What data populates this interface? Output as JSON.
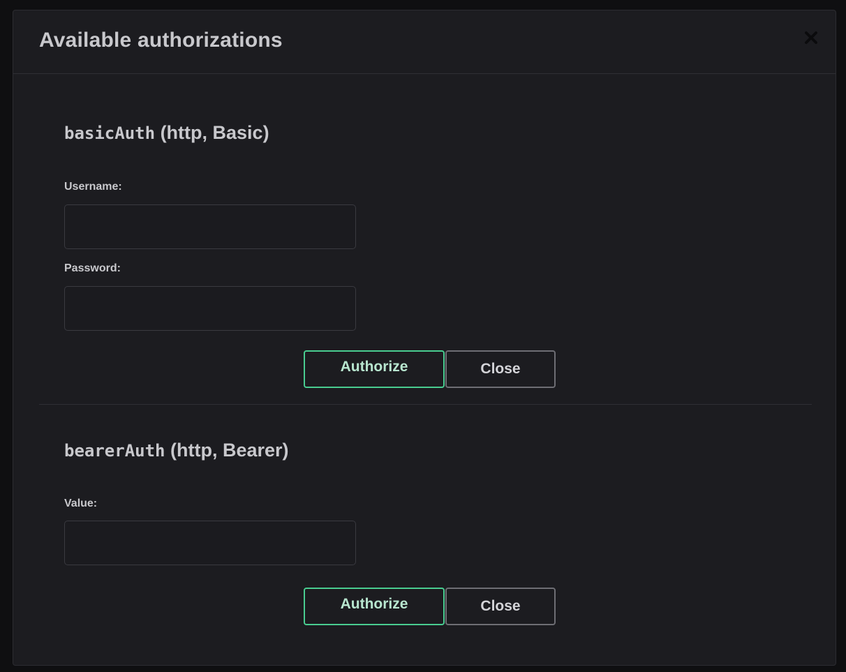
{
  "modal": {
    "title": "Available authorizations",
    "close_icon": "close-icon"
  },
  "sections": [
    {
      "scheme_name": "basicAuth",
      "scheme_type": "(http, Basic)",
      "fields": [
        {
          "label": "Username:",
          "value": "",
          "placeholder": ""
        },
        {
          "label": "Password:",
          "value": "",
          "placeholder": ""
        }
      ],
      "authorize_label": "Authorize",
      "close_label": "Close"
    },
    {
      "scheme_name": "bearerAuth",
      "scheme_type": "(http, Bearer)",
      "fields": [
        {
          "label": "Value:",
          "value": "",
          "placeholder": ""
        }
      ],
      "authorize_label": "Authorize",
      "close_label": "Close"
    }
  ],
  "colors": {
    "accent": "#49cc90",
    "modal_bg": "#1c1c20",
    "text": "#c8c8cc"
  }
}
